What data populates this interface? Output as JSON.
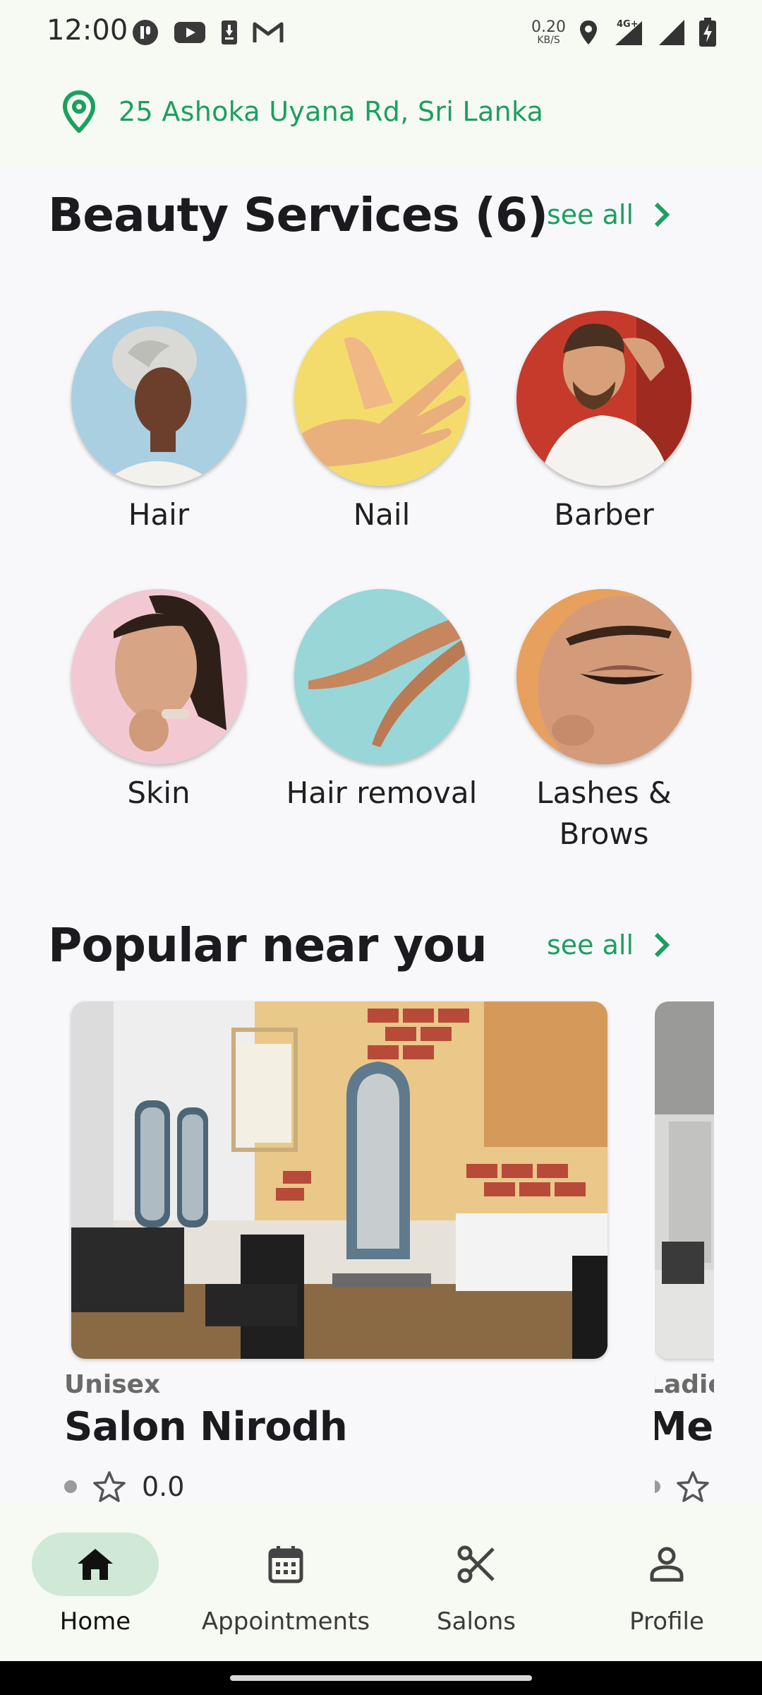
{
  "status_bar": {
    "time": "12:00",
    "net_speed_value": "0.20",
    "net_speed_unit": "KB/S",
    "left_icons": [
      "pause-app-icon",
      "youtube-icon",
      "download-icon",
      "gmail-icon"
    ],
    "right_icons": [
      "location-icon",
      "4g-signal-icon",
      "signal-icon",
      "battery-charging-icon"
    ]
  },
  "location": {
    "address": "25 Ashoka Uyana Rd, Sri Lanka",
    "icon": "map-pin-icon"
  },
  "beauty_services": {
    "title": "Beauty Services (6)",
    "see_all": "see all",
    "categories": [
      {
        "label": "Hair"
      },
      {
        "label": "Nail"
      },
      {
        "label": "Barber"
      },
      {
        "label": "Skin"
      },
      {
        "label": "Hair removal"
      },
      {
        "label": "Lashes &"
      },
      {
        "label": "Brows"
      }
    ]
  },
  "popular": {
    "title": "Popular near you",
    "see_all": "see all",
    "salons": [
      {
        "kind": "Unisex",
        "name": "Salon Nirodh",
        "rating": "0.0"
      },
      {
        "kind": "Ladie",
        "name": "Mer",
        "rating": ""
      }
    ]
  },
  "bottom_nav": {
    "items": [
      {
        "label": "Home",
        "icon": "home-icon",
        "active": true
      },
      {
        "label": "Appointments",
        "icon": "calendar-icon",
        "active": false
      },
      {
        "label": "Salons",
        "icon": "scissors-icon",
        "active": false
      },
      {
        "label": "Profile",
        "icon": "person-icon",
        "active": false
      }
    ]
  },
  "colors": {
    "accent": "#1aa05f",
    "nav_active_pill": "#cfe9d6",
    "background": "#f8f8fa"
  }
}
